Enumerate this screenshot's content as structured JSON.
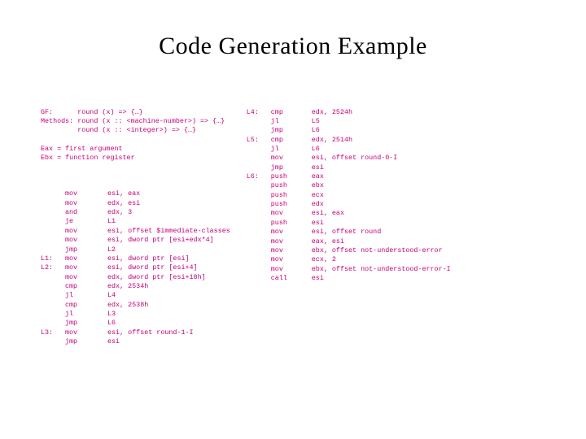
{
  "title": "Code Generation Example",
  "left_header": "GF:      round (x) => {…}\nMethods: round (x :: <machine-number>) => {…}\n         round (x :: <integer>) => {…}\n\nEax = first argument\nEbx = function register",
  "left_labels": " \n \n \n \n \n \n \nL1:\nL2:\n \n \n \n \n \n \nL3:\n ",
  "left_mnem": "mov\nmov\nand\nje\nmov\nmov\njmp\nmov\nmov\nmov\ncmp\njl\ncmp\njl\njmp\nmov\njmp",
  "left_ops": "esi, eax\nedx, esi\nedx, 3\nL1\nesi, offset $immediate-classes\nesi, dword ptr [esi+edx*4]\nL2\nesi, dword ptr [esi]\nesi, dword ptr [esi+4]\nedx, dword ptr [esi+18h]\nedx, 2534h\nL4\nedx, 2538h\nL3\nL6\nesi, offset round-1-I\nesi",
  "right_labels": "L4:\n \n \nL5:\n \n \n \nL6:\n \n \n \n \n \n \n \n \n \n \n ",
  "right_mnem": "cmp\njl\njmp\ncmp\njl\nmov\njmp\npush\npush\npush\npush\nmov\npush\nmov\nmov\nmov\nmov\nmov\ncall",
  "right_ops": "edx, 2524h\nL5\nL6\nedx, 2514h\nL6\nesi, offset round-0-I\nesi\neax\nebx\necx\nedx\nesi, eax\nesi\nesi, offset round\neax, esi\nebx, offset not-understood-error\necx, 2\nebx, offset not-understood-error-I\nesi"
}
